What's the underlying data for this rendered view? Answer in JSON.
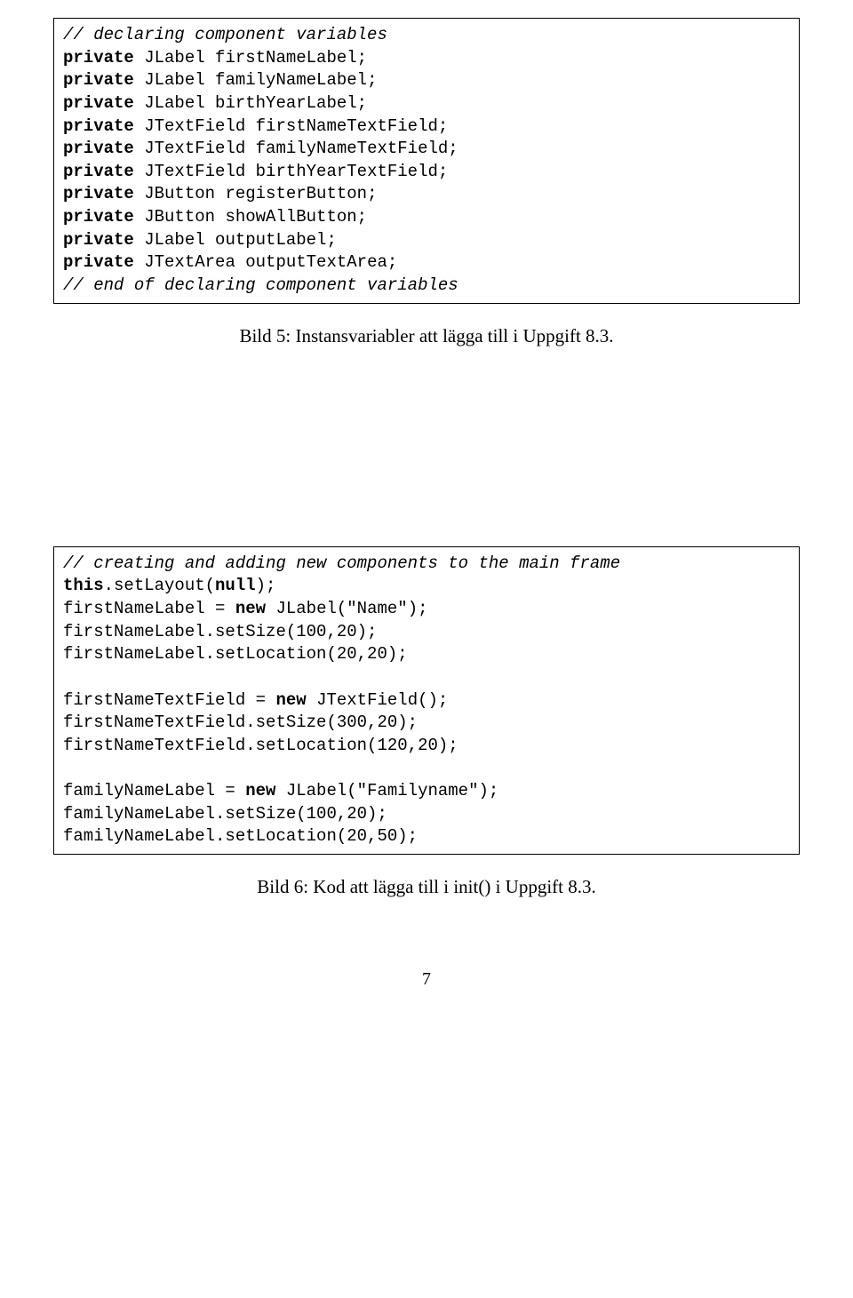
{
  "code_block_1": {
    "c1": "// declaring component variables",
    "kw": "private",
    "l2": " JLabel firstNameLabel;",
    "l3": " JLabel familyNameLabel;",
    "l4": " JLabel birthYearLabel;",
    "l5": " JTextField firstNameTextField;",
    "l6": " JTextField familyNameTextField;",
    "l7": " JTextField birthYearTextField;",
    "l8": " JButton registerButton;",
    "l9": " JButton showAllButton;",
    "l10": " JLabel outputLabel;",
    "l11": " JTextArea outputTextArea;",
    "c12": "// end of declaring component variables"
  },
  "caption1": "Bild 5: Instansvariabler att lägga till i Uppgift 8.3.",
  "code_block_2": {
    "c1": "// creating and adding new components to the main frame",
    "kw_this": "this",
    "kw_null": "null",
    "kw_new": "new",
    "l2a": ".setLayout(",
    "l2b": ");",
    "l3a": "firstNameLabel = ",
    "l3b": " JLabel(\"Name\");",
    "l4": "firstNameLabel.setSize(100,20);",
    "l5": "firstNameLabel.setLocation(20,20);",
    "l7a": "firstNameTextField = ",
    "l7b": " JTextField();",
    "l8": "firstNameTextField.setSize(300,20);",
    "l9": "firstNameTextField.setLocation(120,20);",
    "l11a": "familyNameLabel = ",
    "l11b": " JLabel(\"Familyname\");",
    "l12": "familyNameLabel.setSize(100,20);",
    "l13": "familyNameLabel.setLocation(20,50);"
  },
  "caption2": "Bild 6: Kod att lägga till i init() i Uppgift 8.3.",
  "page_number": "7"
}
